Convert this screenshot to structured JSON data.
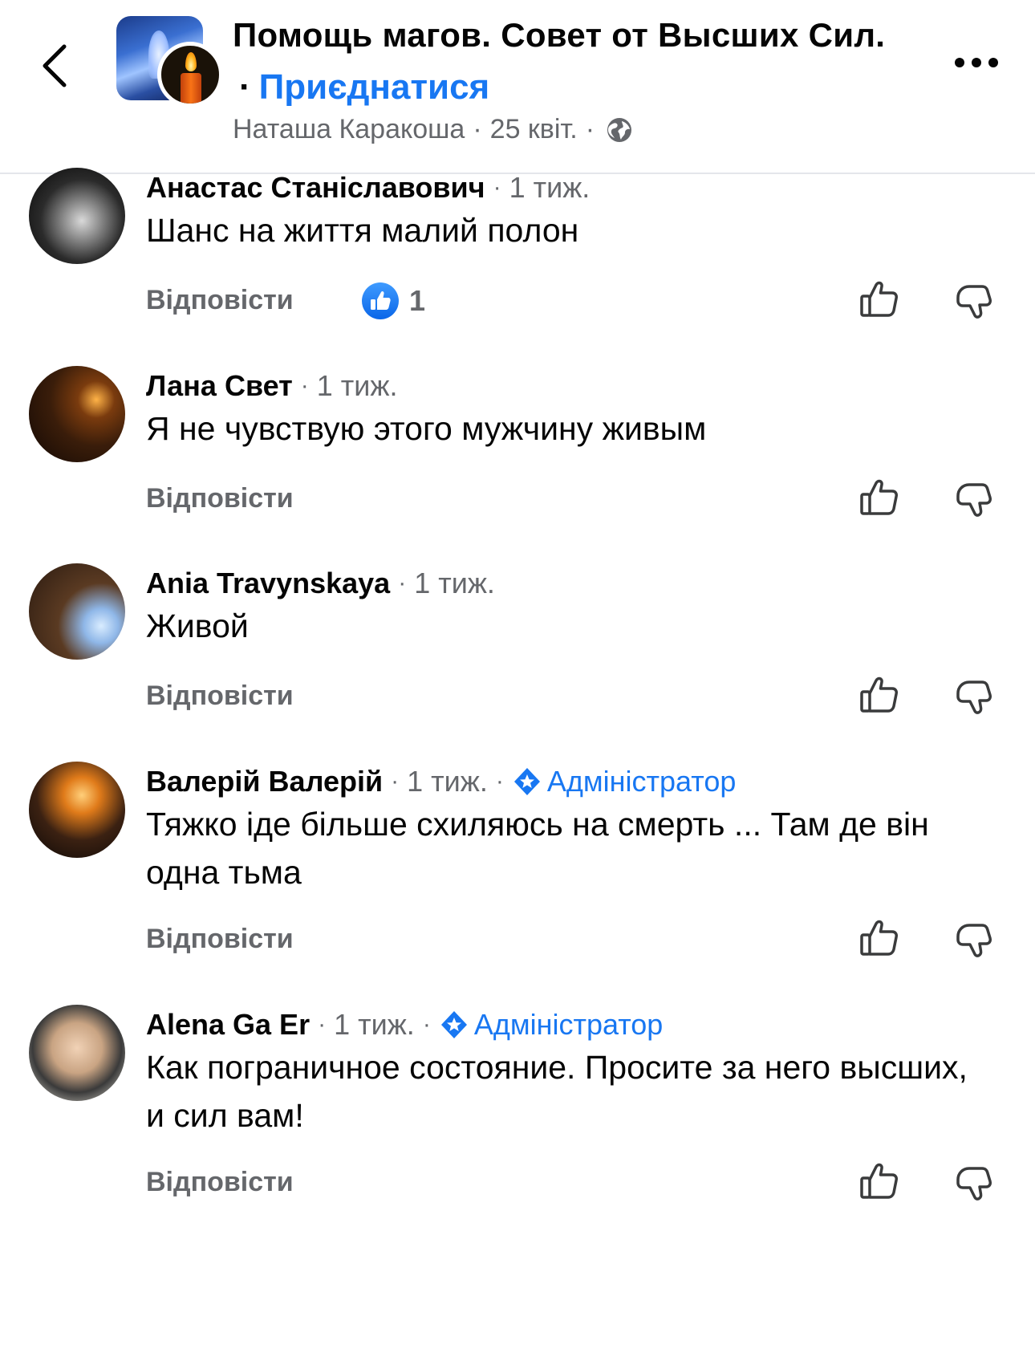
{
  "header": {
    "group_name": "Помощь магов. Совет от Высших Сил.",
    "dot": "·",
    "join_label": "Приєднатися",
    "post_author": "Наташа Каракоша",
    "separator": "·",
    "post_date": "25 квіт.",
    "privacy_icon": "globe-icon",
    "back_icon": "chevron-left-icon",
    "more_icon": "more-horizontal-icon"
  },
  "comments": [
    {
      "author": "Анастас Станіславович",
      "sep": "·",
      "time": "1 тиж.",
      "text": "Шанс на життя малий полон",
      "reply_label": "Відповісти",
      "reaction_count": "1"
    },
    {
      "author": "Лана Свет",
      "sep": "·",
      "time": "1 тиж.",
      "text": "Я не чувствую  этого мужчину живым",
      "reply_label": "Відповісти"
    },
    {
      "author": "Ania Travynskaya",
      "sep": "·",
      "time": "1 тиж.",
      "text": "Живой",
      "reply_label": "Відповісти"
    },
    {
      "author": "Валерій Валерій",
      "sep": "·",
      "time": "1 тиж.",
      "sep2": "·",
      "badge": "Адміністратор",
      "text": "Тяжко іде більше схиляюсь на смерть ... Там де він одна тьма",
      "reply_label": "Відповісти"
    },
    {
      "author": "Alena Ga Er",
      "sep": "·",
      "time": "1 тиж.",
      "sep2": "·",
      "badge": "Адміністратор",
      "text": "Как пограничное состояние. Просите за него высших, и сил вам!",
      "reply_label": "Відповісти"
    }
  ],
  "colors": {
    "accent": "#1877f2",
    "secondary_text": "#65676b",
    "primary_text": "#050505",
    "divider": "#e4e6eb"
  }
}
